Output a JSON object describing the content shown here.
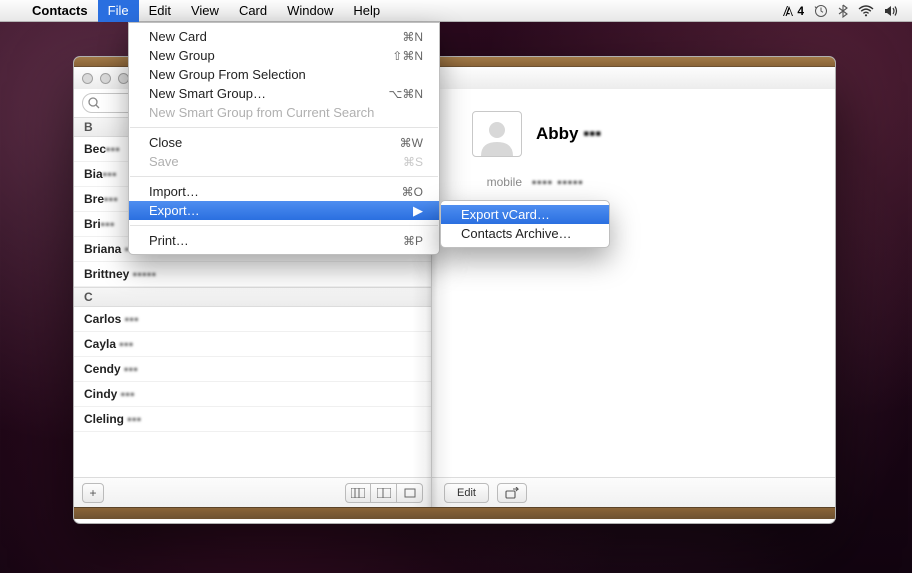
{
  "menubar": {
    "app": "Contacts",
    "items": [
      "File",
      "Edit",
      "View",
      "Card",
      "Window",
      "Help"
    ],
    "active_index": 0,
    "right": {
      "adobe_label": "4"
    }
  },
  "file_menu": {
    "new_card": {
      "label": "New Card",
      "shortcut": "⌘N"
    },
    "new_group": {
      "label": "New Group",
      "shortcut": "⇧⌘N"
    },
    "new_group_from_selection": {
      "label": "New Group From Selection"
    },
    "new_smart_group": {
      "label": "New Smart Group…",
      "shortcut": "⌥⌘N"
    },
    "new_smart_group_from_search": {
      "label": "New Smart Group from Current Search"
    },
    "close": {
      "label": "Close",
      "shortcut": "⌘W"
    },
    "save": {
      "label": "Save",
      "shortcut": "⌘S"
    },
    "import": {
      "label": "Import…",
      "shortcut": "⌘O"
    },
    "export": {
      "label": "Export…"
    },
    "print": {
      "label": "Print…",
      "shortcut": "⌘P"
    }
  },
  "export_submenu": {
    "vcard": {
      "label": "Export vCard…"
    },
    "archive": {
      "label": "Contacts Archive…"
    }
  },
  "contacts_list": {
    "sections": [
      {
        "letter": "B",
        "rows": [
          {
            "first": "Bec",
            "rest": "▪▪▪"
          },
          {
            "first": "Bia",
            "rest": "▪▪▪"
          },
          {
            "first": "Bre",
            "rest": "▪▪▪"
          },
          {
            "first": "Bri",
            "rest": "▪▪▪"
          },
          {
            "first": "Briana",
            "rest": "▪▪▪"
          },
          {
            "first": "Brittney",
            "rest": "▪▪▪▪▪"
          }
        ]
      },
      {
        "letter": "C",
        "rows": [
          {
            "first": "Carlos",
            "rest": "▪▪▪"
          },
          {
            "first": "Cayla",
            "rest": "▪▪▪"
          },
          {
            "first": "Cendy",
            "rest": "▪▪▪"
          },
          {
            "first": "Cindy",
            "rest": "▪▪▪"
          },
          {
            "first": "Cleling",
            "rest": "▪▪▪"
          }
        ]
      }
    ]
  },
  "detail": {
    "first_name": "Abby",
    "last_blur": "▪▪▪",
    "mobile_label": "mobile",
    "mobile_blur": "▪▪▪▪ ▪▪▪▪▪"
  },
  "buttons": {
    "edit": "Edit",
    "add": "+"
  },
  "search": {
    "placeholder": ""
  }
}
